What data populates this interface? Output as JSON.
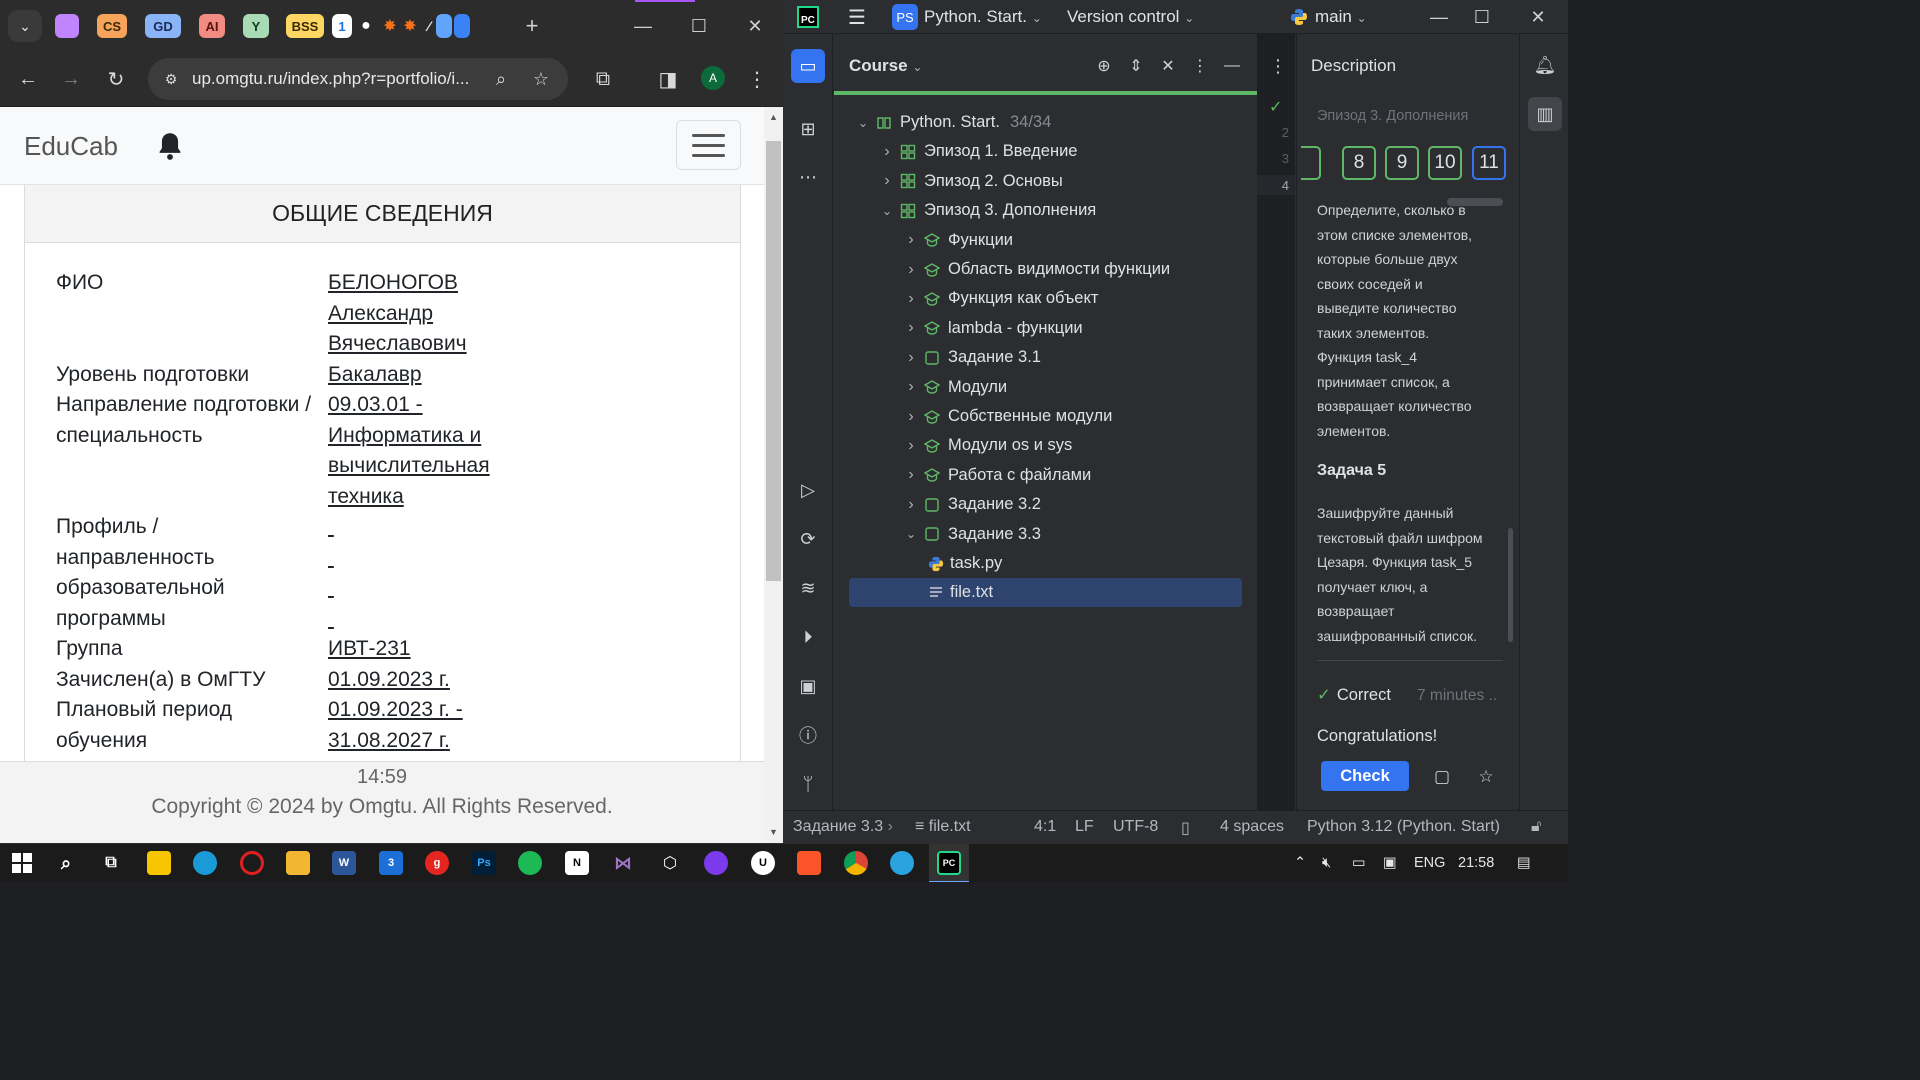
{
  "browser": {
    "bookmark_tabs": [
      "CS",
      "GD",
      "AI",
      "Y",
      "BSS"
    ],
    "address_url": "up.omgtu.ru/index.php?r=portfolio/i...",
    "profile_initial": "A"
  },
  "site": {
    "brand": "EduCab",
    "card_title": "ОБЩИЕ СВЕДЕНИЯ",
    "fields": [
      {
        "label": [
          "ФИО"
        ],
        "value": [
          "БЕЛОНОГОВ",
          "Александр",
          "Вячеславович"
        ]
      },
      {
        "label": [
          "Уровень подготовки"
        ],
        "value": [
          "Бакалавр"
        ]
      },
      {
        "label": [
          "",
          "Направление подготовки /",
          "специальность"
        ],
        "value": [
          "09.03.01 -",
          "Информатика и",
          "вычислительная",
          "техника"
        ]
      },
      {
        "label": [
          "Профиль /",
          "направленность",
          "образовательной",
          "программы"
        ],
        "value": []
      },
      {
        "label": [
          "Группа"
        ],
        "value": [
          "ИВТ-231"
        ]
      },
      {
        "label": [
          "Зачислен(а) в ОмГТУ"
        ],
        "value": [
          "01.09.2023 г."
        ]
      },
      {
        "label": [
          "Плановый период",
          "обучения"
        ],
        "value": [
          "01.09.2023 г. -",
          "31.08.2027 г."
        ]
      }
    ],
    "footer_time": "14:59",
    "footer_copy": "Copyright © 2024 by Omgtu. All Rights Reserved."
  },
  "ide": {
    "project_badge": "PS",
    "project_name": "Python. Start.",
    "vcs_label": "Version control",
    "branch": "main",
    "panel_title": "Course",
    "tree": [
      {
        "label": "Python. Start.",
        "count": "34/34",
        "level": 0,
        "chev": "down",
        "icon": "course-book-icon"
      },
      {
        "label": "Эпизод 1. Введение",
        "level": 1,
        "chev": "right",
        "icon": "lesson-grid-icon"
      },
      {
        "label": "Эпизод 2. Основы",
        "level": 1,
        "chev": "right",
        "icon": "lesson-grid-icon"
      },
      {
        "label": "Эпизод 3. Дополнения",
        "level": 1,
        "chev": "down",
        "icon": "lesson-grid-icon"
      },
      {
        "label": "Функции",
        "level": 2,
        "chev": "right",
        "icon": "theory-cap-icon"
      },
      {
        "label": "Область видимости функции",
        "level": 2,
        "chev": "right",
        "icon": "theory-cap-icon"
      },
      {
        "label": "Функция как объект",
        "level": 2,
        "chev": "right",
        "icon": "theory-cap-icon"
      },
      {
        "label": "lambda - функции",
        "level": 2,
        "chev": "right",
        "icon": "theory-cap-icon"
      },
      {
        "label": "Задание 3.1",
        "level": 2,
        "chev": "right",
        "icon": "task-square-icon"
      },
      {
        "label": "Модули",
        "level": 2,
        "chev": "right",
        "icon": "theory-cap-icon"
      },
      {
        "label": "Собственные модули",
        "level": 2,
        "chev": "right",
        "icon": "theory-cap-icon"
      },
      {
        "label": "Модули os и sys",
        "level": 2,
        "chev": "right",
        "icon": "theory-cap-icon"
      },
      {
        "label": "Работа с файлами",
        "level": 2,
        "chev": "right",
        "icon": "theory-cap-icon"
      },
      {
        "label": "Задание 3.2",
        "level": 2,
        "chev": "right",
        "icon": "task-square-icon"
      },
      {
        "label": "Задание 3.3",
        "level": 2,
        "chev": "down",
        "icon": "task-square-icon"
      },
      {
        "label": "task.py",
        "level": 3,
        "chev": "",
        "icon": "python-file-icon"
      },
      {
        "label": "file.txt",
        "level": 3,
        "chev": "",
        "icon": "text-file-icon",
        "selected": true
      }
    ],
    "gutter_lines": [
      "2",
      "3",
      "4"
    ],
    "description": {
      "title": "Description",
      "lesson": "Эпизод 3. Дополнения",
      "steps": [
        "8",
        "9",
        "10",
        "11"
      ],
      "task4_text": [
        "Определите, сколько в",
        "этом списке элементов,",
        "которые больше двух",
        "своих соседей и",
        "выведите количество",
        "таких элементов.",
        "Функция task_4",
        "принимает список, а",
        "возвращает количество",
        "элементов."
      ],
      "task5_heading": "Задача 5",
      "task5_text": [
        "Зашифруйте данный",
        "текстовый файл шифром",
        "Цезаря. Функция task_5",
        "получает ключ, а",
        "возвращает",
        "зашифрованный список."
      ],
      "status": "Correct",
      "status_time": "7 minutes ..",
      "congrats": "Congratulations!",
      "check_label": "Check"
    },
    "status_bar": {
      "breadcrumb": "Задание 3.3",
      "file": "file.txt",
      "position": "4:1",
      "line_sep": "LF",
      "encoding": "UTF-8",
      "indent": "4 spaces",
      "interpreter": "Python 3.12 (Python. Start)"
    }
  },
  "taskbar": {
    "lang": "ENG",
    "clock": "21:58"
  },
  "colors": {
    "ide_accent": "#3574f0",
    "success_green": "#5fb865",
    "selection": "#2e436e"
  }
}
